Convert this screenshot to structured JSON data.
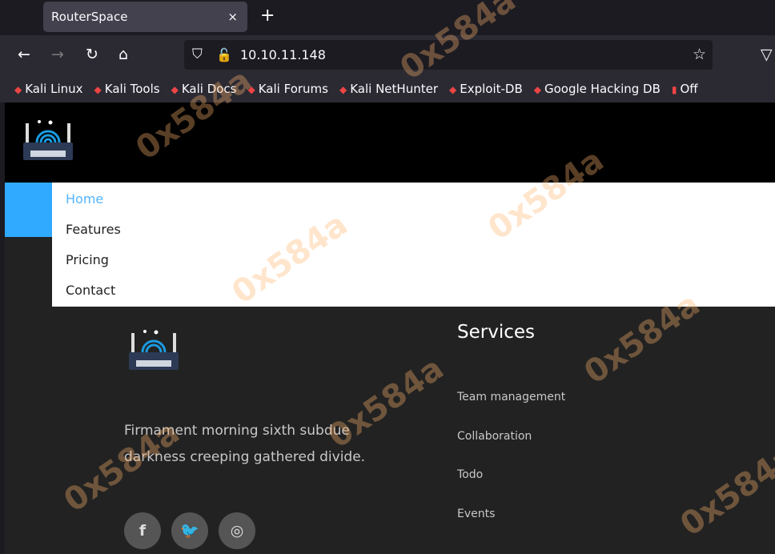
{
  "browser": {
    "tab_title": "RouterSpace",
    "tab_close": "×",
    "new_tab": "+",
    "url": "10.10.11.148",
    "bookmarks": [
      "Kali Linux",
      "Kali Tools",
      "Kali Docs",
      "Kali Forums",
      "Kali NetHunter",
      "Exploit-DB",
      "Google Hacking DB",
      "Off"
    ]
  },
  "nav": {
    "items": [
      "Home",
      "Features",
      "Pricing",
      "Contact"
    ],
    "active": "Home"
  },
  "footer": {
    "description": "Firmament morning sixth subdue darkness creeping gathered divide.",
    "social": [
      "f",
      "t",
      "ig"
    ],
    "services_title": "Services",
    "services": [
      "Team management",
      "Collaboration",
      "Todo",
      "Events"
    ]
  },
  "watermark": "0x584a",
  "colors": {
    "accent": "#2faaff",
    "active_link": "#54b5ff"
  }
}
